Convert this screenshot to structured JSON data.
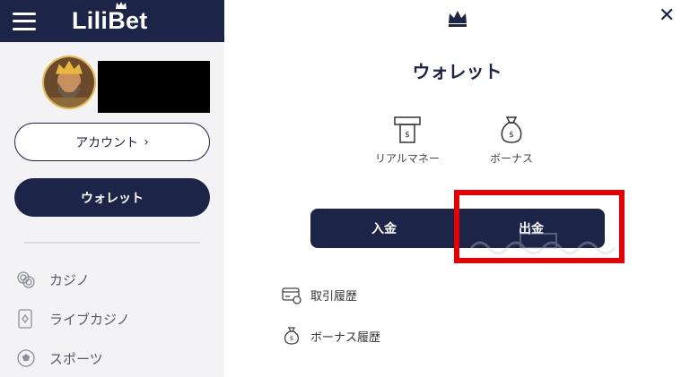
{
  "sidebar": {
    "brand": "LiliBet",
    "account_button": "アカウント",
    "account_chevron": "›",
    "wallet_button": "ウォレット",
    "nav": [
      {
        "label": "カジノ",
        "icon": "chips-icon"
      },
      {
        "label": "ライブカジノ",
        "icon": "card-icon"
      },
      {
        "label": "スポーツ",
        "icon": "football-icon"
      }
    ]
  },
  "main": {
    "close_glyph": "✕",
    "title": "ウォレット",
    "tabs": [
      {
        "label": "リアルマネー",
        "icon": "atm-icon"
      },
      {
        "label": "ボーナス",
        "icon": "money-bag-icon"
      }
    ],
    "actions": {
      "deposit": "入金",
      "withdraw": "出金"
    },
    "links": [
      {
        "label": "取引履歴",
        "icon": "credit-card-icon"
      },
      {
        "label": "ボーナス履歴",
        "icon": "money-bag-icon"
      }
    ]
  },
  "colors": {
    "navy": "#1c2447",
    "highlight": "#e90000",
    "sidebar_bg": "#f3f3f5"
  }
}
